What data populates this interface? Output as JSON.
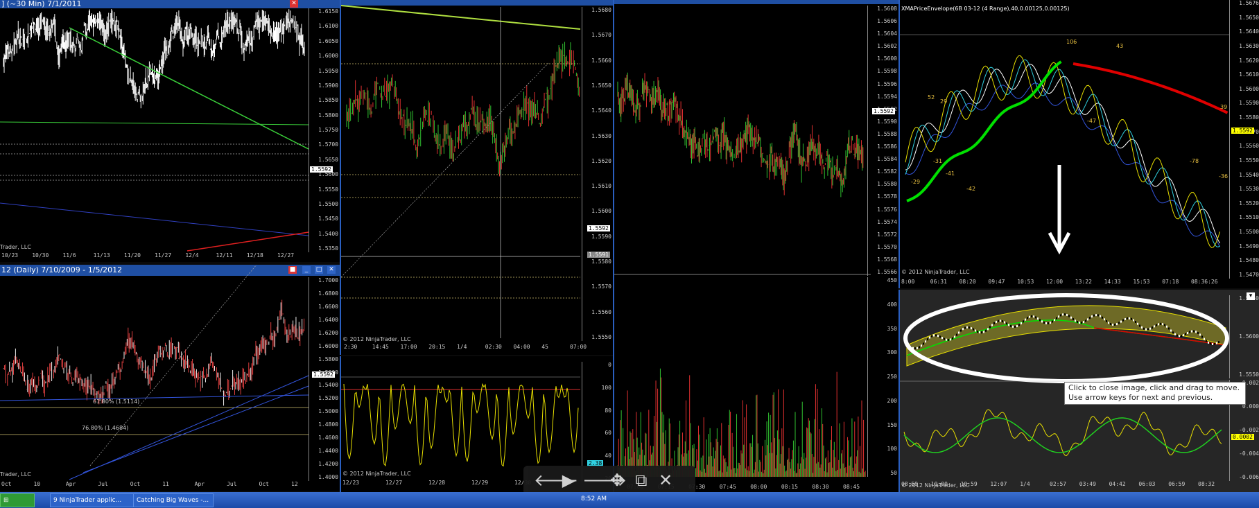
{
  "windows": {
    "w1": {
      "title": "]   (~30 Min)   7/1/2011",
      "price_label": "1.5592",
      "watermark": "Trader, LLC",
      "ticks": [
        "1.6150",
        "1.6100",
        "1.6050",
        "1.6000",
        "1.5950",
        "1.5900",
        "1.5850",
        "1.5800",
        "1.5750",
        "1.5700",
        "1.5650",
        "1.5600",
        "1.5550",
        "1.5500",
        "1.5450",
        "1.5400",
        "1.5350"
      ],
      "xlabels": [
        "10/23",
        "10/30",
        "11/6",
        "11/13",
        "11/20",
        "11/27",
        "12/4",
        "12/11",
        "12/18",
        "12/27"
      ]
    },
    "w2": {
      "title": "12 (Daily)  7/10/2009 - 1/5/2012",
      "price_label": "1.5592",
      "watermark": "Trader, LLC",
      "ticks": [
        "1.7000",
        "1.6800",
        "1.6600",
        "1.6400",
        "1.6200",
        "1.6000",
        "1.5800",
        "1.5600",
        "1.5400",
        "1.5200",
        "1.5000",
        "1.4800",
        "1.4600",
        "1.4400",
        "1.4200",
        "1.4000"
      ],
      "xlabels": [
        "Oct",
        "10",
        "Apr",
        "Jul",
        "Oct",
        "11",
        "Apr",
        "Jul",
        "Oct",
        "12"
      ],
      "fib1": "61.80% (1.5114)",
      "fib2": "76.80% (1.4684)"
    },
    "w3": {
      "title": "",
      "price_label": "1.5592",
      "price_label2": "1.5591",
      "watermark": "© 2012 NinjaTrader, LLC",
      "ticks": [
        "1.5680",
        "1.5670",
        "1.5660",
        "1.5650",
        "1.5640",
        "1.5630",
        "1.5620",
        "1.5610",
        "1.5600",
        "1.5590",
        "1.5580",
        "1.5570",
        "1.5560",
        "1.5550"
      ],
      "xlabels": [
        "2:30",
        "14:45",
        "17:00",
        "20:15",
        "1/4",
        "02:30",
        "04:00",
        "45",
        "07:00"
      ]
    },
    "w4": {
      "watermark": "© 2012 NinjaTrader, LLC",
      "ticks": [
        "0",
        "100",
        "80",
        "60",
        "40",
        "20"
      ],
      "xlabels": [
        "12/23",
        "12/27",
        "12/28",
        "12/29",
        "12/30"
      ],
      "value": "2.38"
    },
    "w5": {
      "price_label": "1.5592",
      "ticks": [
        "1.5608",
        "1.5606",
        "1.5604",
        "1.5602",
        "1.5600",
        "1.5598",
        "1.5596",
        "1.5594",
        "1.5592",
        "1.5590",
        "1.5588",
        "1.5586",
        "1.5584",
        "1.5582",
        "1.5580",
        "1.5578",
        "1.5576",
        "1.5574",
        "1.5572",
        "1.5570",
        "1.5568",
        "1.5566"
      ],
      "vticks": [
        "450",
        "400",
        "350",
        "300",
        "250",
        "200",
        "150",
        "100",
        "50"
      ],
      "xlabels": [
        "07:00",
        "07:15",
        "07:30",
        "07:45",
        "08:00",
        "08:15",
        "08:30",
        "08:45"
      ]
    },
    "w6": {
      "title": "XMAPriceEnvelope(6B 03-12 (4 Range),40,0.00125,0.00125)",
      "price_label": "1.5592",
      "watermark": "© 2012 NinjaTrader, LLC",
      "ticks": [
        "1.5676",
        "1.5650",
        "1.5640",
        "1.5630",
        "1.5620",
        "1.5610",
        "1.5600",
        "1.5590",
        "1.5580",
        "1.5570",
        "1.5560",
        "1.5550",
        "1.5540",
        "1.5530",
        "1.5520",
        "1.5510",
        "1.5500",
        "1.5490",
        "1.5480",
        "1.5470"
      ],
      "xlabels": [
        "8:00",
        "06:31",
        "08:20",
        "09:47",
        "10:53",
        "12:00",
        "13:22",
        "14:33",
        "15:53",
        "07:18",
        "08:36:26"
      ],
      "annotations": [
        "106",
        "43",
        "52",
        "29",
        "-47",
        "-31",
        "-41",
        "-42",
        "-29",
        "-78",
        "-36",
        "39"
      ]
    },
    "w7": {
      "watermark": "© 2012 NinjaTrader, LLC",
      "ticks": [
        "1.5650",
        "1.5600",
        "1.5550"
      ],
      "oticks": [
        "0.002",
        "0.000",
        "-0.002",
        "-0.004",
        "-0.006"
      ],
      "value": "0.0002",
      "xlabels": [
        "08:59",
        "10:00",
        "10:59",
        "12:07",
        "1/4",
        "02:57",
        "03:49",
        "04:42",
        "06:03",
        "06:59",
        "08:32"
      ]
    }
  },
  "tooltip": {
    "text": "Click to close image, click and drag to move. Use arrow keys for next and previous."
  },
  "viewer_toolbar": {
    "prev": "previous-arrow",
    "play": "play",
    "next": "next-arrow",
    "move": "move",
    "popout": "pop-out",
    "close": "close"
  },
  "taskbar": {
    "start": "start",
    "app1": "9 NinjaTrader applic...",
    "app2": "Catching Big Waves -...",
    "clock": "8:52 AM"
  },
  "colors": {
    "green": "#00c800",
    "red": "#e00000",
    "yellow": "#e8e000",
    "blue": "#3355dd",
    "cyan": "#30d0e0"
  }
}
